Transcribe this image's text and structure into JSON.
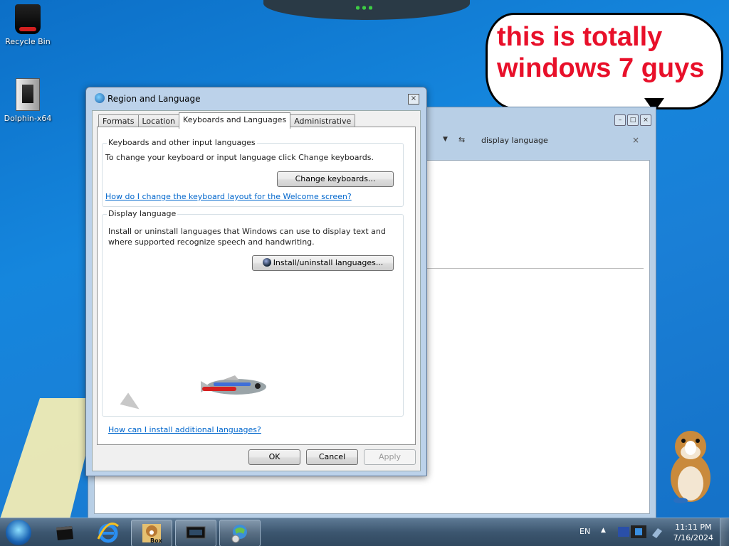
{
  "desktop": {
    "icons": [
      {
        "label": "Recycle Bin",
        "icon": "recycle-bin-icon"
      },
      {
        "label": "Dolphin-x64",
        "icon": "dolphin-app-icon"
      }
    ],
    "bubble_text": "this is totally windows 7 guys",
    "bubble_color": "#e8102a"
  },
  "background_window": {
    "address_text": "display language",
    "close_search": "×"
  },
  "dialog": {
    "title": "Region and Language",
    "tabs": [
      "Formats",
      "Location",
      "Keyboards and Languages",
      "Administrative"
    ],
    "active_tab": "Keyboards and Languages",
    "keyboards": {
      "legend": "Keyboards and other input languages",
      "description": "To change your keyboard or input language click Change keyboards.",
      "button": "Change keyboards...",
      "link": "How do I change the keyboard layout for the Welcome screen?"
    },
    "display": {
      "legend": "Display language",
      "description": "Install or uninstall languages that Windows can use to display text and where supported recognize speech and handwriting.",
      "button": "Install/uninstall languages..."
    },
    "bottom_link": "How can I install additional languages?",
    "buttons": {
      "ok": "OK",
      "cancel": "Cancel",
      "apply": "Apply"
    }
  },
  "taskbar": {
    "language": "EN",
    "time": "11:11 PM",
    "date": "7/16/2024",
    "items": [
      "media-center-icon",
      "internet-explorer-icon",
      "sandbox-hamster-icon",
      "monitor-app-icon",
      "region-language-icon"
    ],
    "box_label": "Box"
  }
}
